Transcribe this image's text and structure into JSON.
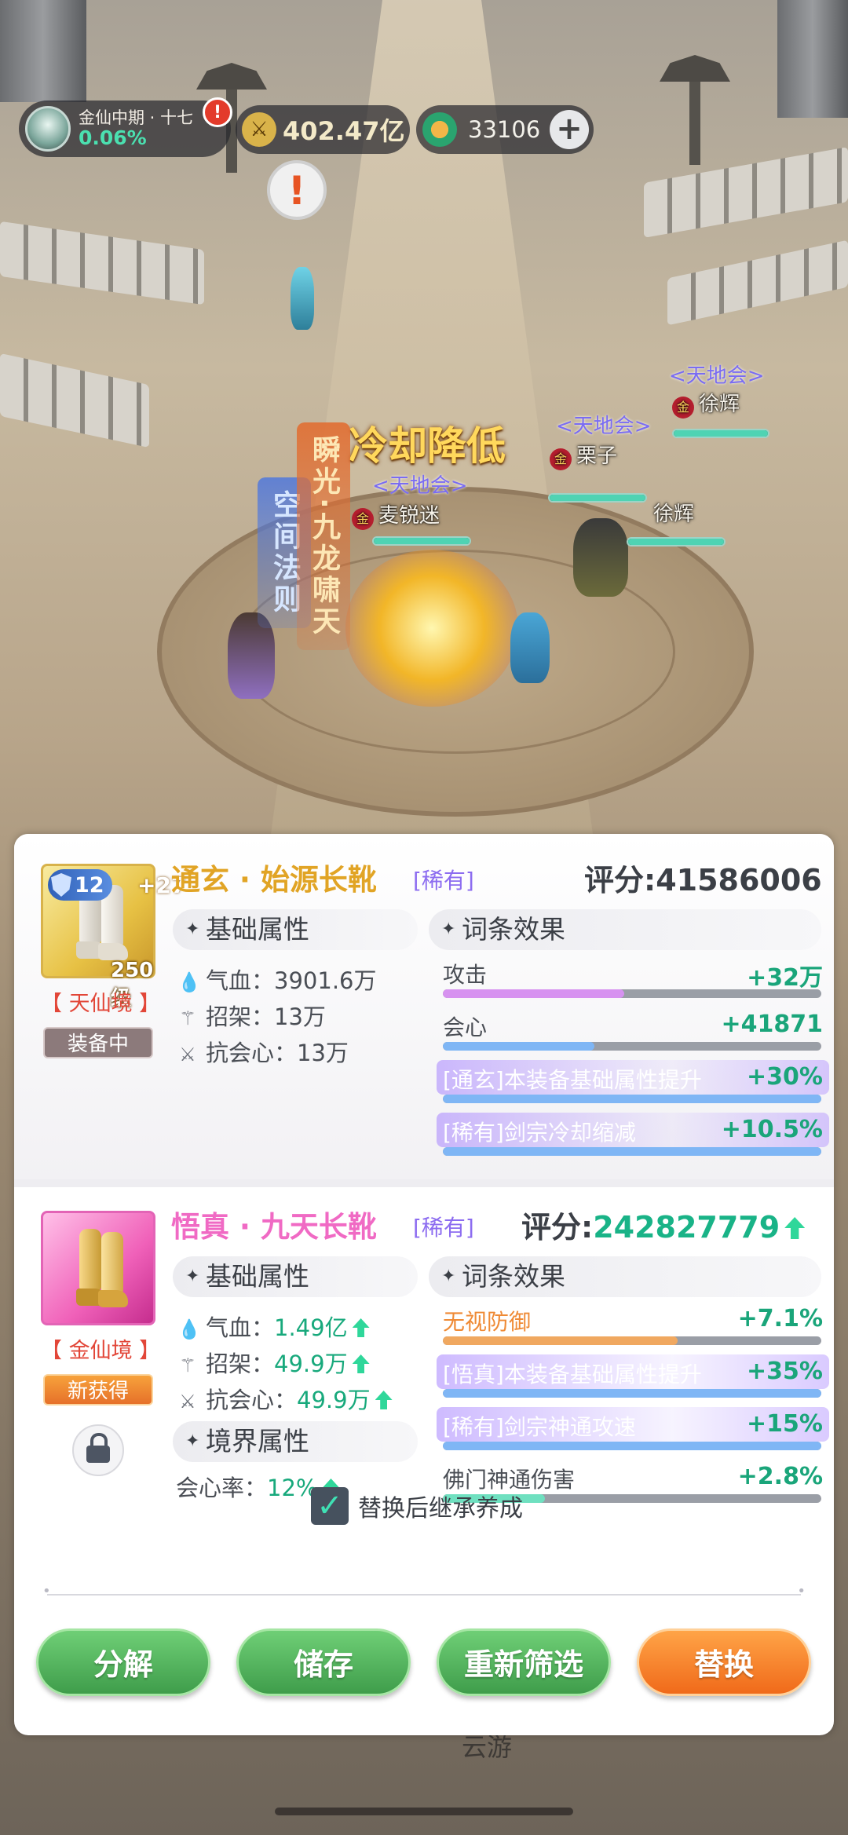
{
  "hud": {
    "realm_name": "金仙中期 · 十七",
    "realm_progress": "0.06%",
    "alert_badge": "!",
    "combat_power": "402.47亿",
    "currency_amount": "33106",
    "plus_label": "+",
    "quest_marker": "!"
  },
  "battle": {
    "cooldown_text": "冷却降低",
    "skill_space": "空间法则",
    "skill_nine": "瞬光·九龙啸天",
    "guild_tag": "<天地会>",
    "rank_badge": "金",
    "players": [
      {
        "name": "麦锐迷",
        "hp": 1.0
      },
      {
        "name": "栗子",
        "hp": 1.0
      },
      {
        "name": "徐辉",
        "hp": 1.0
      }
    ],
    "pet_name": "徐辉",
    "footer_label": "云游"
  },
  "equipped": {
    "name": "通玄 · 始源长靴",
    "rarity": "[稀有]",
    "score_label": "评分:",
    "score": "41586006",
    "level_badge": "12",
    "enhance": "+27",
    "grade": "250级",
    "realm": "【 天仙境 】",
    "status": "装备中",
    "base_header": "基础属性",
    "affix_header": "词条效果",
    "base_stats": [
      {
        "icon": "blood-icon",
        "label": "气血：",
        "value": "3901.6万"
      },
      {
        "icon": "parry-icon",
        "label": "招架：",
        "value": "13万"
      },
      {
        "icon": "anti-crit-icon",
        "label": "抗会心：",
        "value": "13万"
      }
    ],
    "affixes": [
      {
        "label": "攻击",
        "value": "+32万",
        "fill": 0.48,
        "label_color": "#4a4e55",
        "value_color": "#1aa57a",
        "bar_color": "#d792f0",
        "glow": false
      },
      {
        "label": "会心",
        "value": "+41871",
        "fill": 0.4,
        "label_color": "#4a4e55",
        "value_color": "#1aa57a",
        "bar_color": "#7fb6f5",
        "glow": false
      },
      {
        "label": "[通玄]本装备基础属性提升",
        "value": "+30%",
        "fill": 1.0,
        "label_color": "#ffffff",
        "value_color": "#1aa57a",
        "bar_color": "#7fb6f5",
        "glow": true
      },
      {
        "label": "[稀有]剑宗冷却缩减",
        "value": "+10.5%",
        "fill": 1.0,
        "label_color": "#ffffff",
        "value_color": "#1aa57a",
        "bar_color": "#7fb6f5",
        "glow": true
      }
    ]
  },
  "candidate": {
    "name": "悟真 · 九天长靴",
    "rarity": "[稀有]",
    "score_label": "评分:",
    "score": "242827779",
    "realm": "【 金仙境 】",
    "status": "新获得",
    "base_header": "基础属性",
    "affix_header": "词条效果",
    "realm_header": "境界属性",
    "base_stats": [
      {
        "icon": "blood-icon",
        "label": "气血：",
        "value": "1.49亿"
      },
      {
        "icon": "parry-icon",
        "label": "招架：",
        "value": "49.9万"
      },
      {
        "icon": "anti-crit-icon",
        "label": "抗会心：",
        "value": "49.9万"
      }
    ],
    "realm_stat": {
      "label": "会心率：",
      "value": "12%"
    },
    "affixes": [
      {
        "label": "无视防御",
        "value": "+7.1%",
        "fill": 0.62,
        "label_color": "#ef8a35",
        "value_color": "#1aa57a",
        "bar_color": "#f0a860",
        "glow": false
      },
      {
        "label": "[悟真]本装备基础属性提升",
        "value": "+35%",
        "fill": 1.0,
        "label_color": "#ffffff",
        "value_color": "#1aa57a",
        "bar_color": "#7fb6f5",
        "glow": true
      },
      {
        "label": "[稀有]剑宗神通攻速",
        "value": "+15%",
        "fill": 1.0,
        "label_color": "#ffffff",
        "value_color": "#1aa57a",
        "bar_color": "#7fb6f5",
        "glow": true
      },
      {
        "label": "佛门神通伤害",
        "value": "+2.8%",
        "fill": 0.27,
        "label_color": "#4a4e55",
        "value_color": "#1aa57a",
        "bar_color": "#6fe0c0",
        "glow": false
      }
    ]
  },
  "inherit_label": "替换后继承养成",
  "inherit_checked": true,
  "buttons": {
    "decompose": "分解",
    "store": "储存",
    "refilter": "重新筛选",
    "replace": "替换"
  }
}
